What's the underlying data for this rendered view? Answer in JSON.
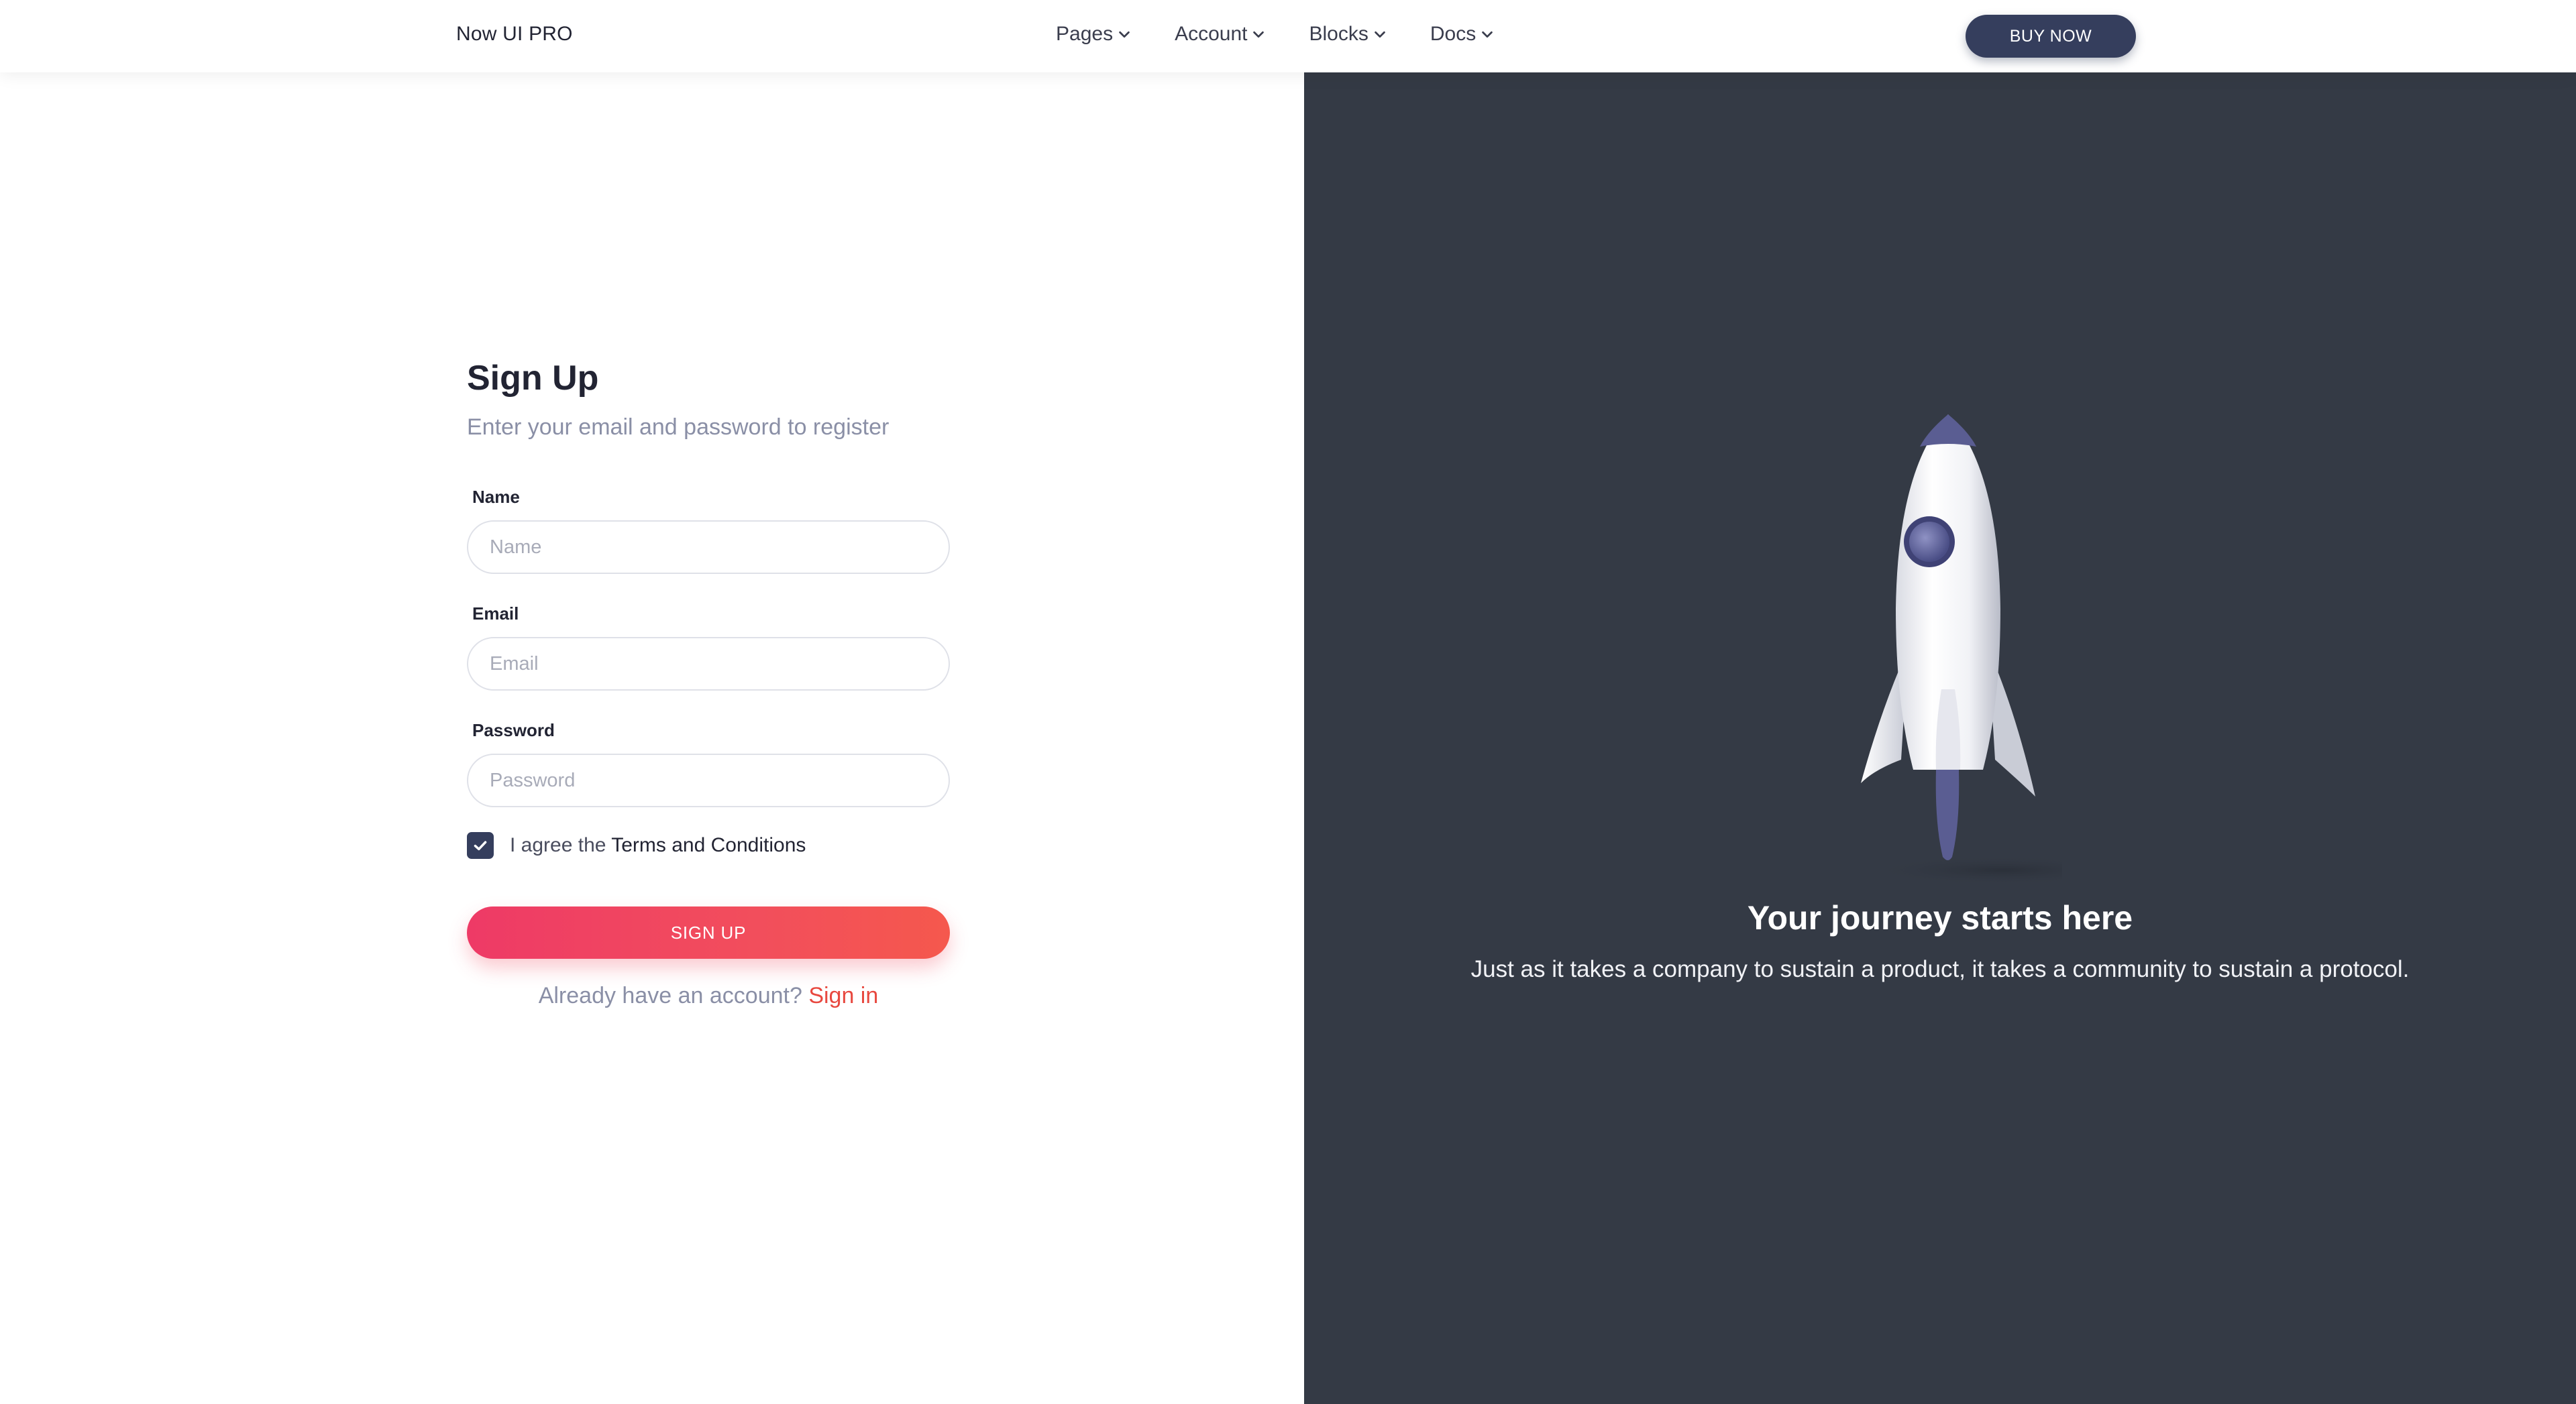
{
  "navbar": {
    "brand": "Now UI PRO",
    "items": [
      {
        "label": "Pages"
      },
      {
        "label": "Account"
      },
      {
        "label": "Blocks"
      },
      {
        "label": "Docs"
      }
    ],
    "cta_label": "BUY NOW"
  },
  "form": {
    "title": "Sign Up",
    "subtitle": "Enter your email and password to register",
    "fields": {
      "name": {
        "label": "Name",
        "placeholder": "Name",
        "value": ""
      },
      "email": {
        "label": "Email",
        "placeholder": "Email",
        "value": ""
      },
      "password": {
        "label": "Password",
        "placeholder": "Password",
        "value": ""
      }
    },
    "agree": {
      "checked": true,
      "prefix": "I agree the ",
      "link": "Terms and Conditions"
    },
    "submit_label": "SIGN UP",
    "footer": {
      "prefix": "Already have an account? ",
      "link": "Sign in"
    }
  },
  "hero": {
    "image_icon": "rocket-icon",
    "title": "Your journey starts here",
    "text": "Just as it takes a company to sustain a product, it takes a community to sustain a protocol."
  },
  "colors": {
    "primary_dark": "#353e5d",
    "panel_bg": "#343a45",
    "accent_gradient_start": "#ee3a66",
    "accent_gradient_end": "#f5584d",
    "link_accent": "#e8483f"
  }
}
